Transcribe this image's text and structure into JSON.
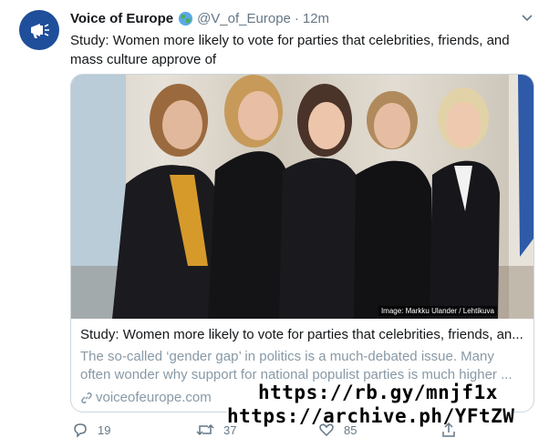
{
  "author": {
    "name": "Voice of Europe",
    "handle": "@V_of_Europe",
    "separator": "·",
    "time": "12m",
    "verified_emoji_icon": "globe-emoji-icon"
  },
  "tweet": {
    "text": "Study: Women more likely to vote for parties that celebrities, friends, and mass culture approve of"
  },
  "card": {
    "image_credit": "Image: Markku Ulander / Lehtikuva",
    "title": "Study: Women more likely to vote for parties that celebrities, friends, an...",
    "description": "The so-called ‘gender gap’ in politics is a much-debated issue. Many often wonder why support for national populist parties is much higher ...",
    "domain": "voiceofeurope.com"
  },
  "overlay": {
    "line1": "https://rb.gy/mnjf1x",
    "line2": "https://archive.ph/YFtZW"
  },
  "actions": {
    "reply_count": "19",
    "retweet_count": "37",
    "like_count": "85"
  },
  "colors": {
    "avatar_bg": "#1f4e9a",
    "secondary_text": "#657786",
    "card_border": "#ccd6dd"
  }
}
